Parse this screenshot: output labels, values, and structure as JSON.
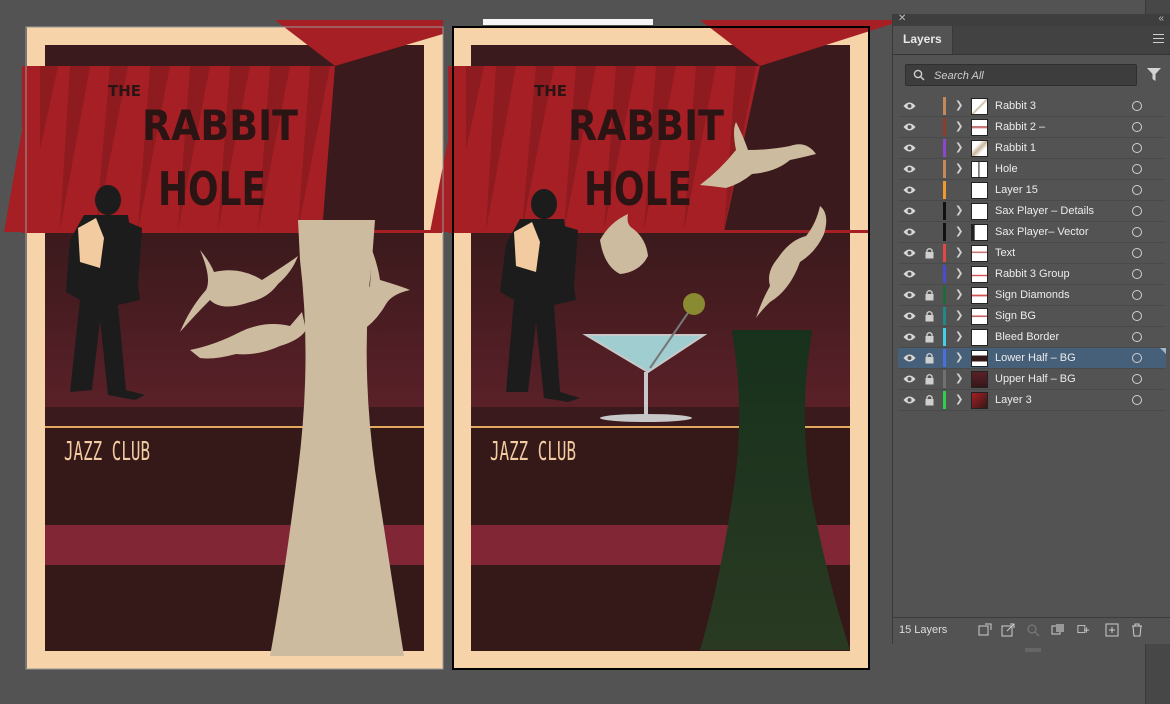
{
  "canvas": {
    "poster": {
      "sign_title_the": "THE",
      "sign_title_rabbit": "RABBIT",
      "sign_title_hole": "HOLE",
      "subtitle": "JAZZ CLUB"
    },
    "colors": {
      "cream_border": "#f6d3a8",
      "dark_maroon": "#351818",
      "upper_maroon": "#5a2028",
      "sign_red": "#a51f24",
      "stripe_red": "#802634",
      "rabbit_beige": "#cdbba0",
      "hole_green": "#1e3a22",
      "gold_line": "#e0a95e"
    }
  },
  "layers_panel": {
    "tab_label": "Layers",
    "search": {
      "placeholder": "Search All"
    },
    "layers": [
      {
        "name": "Rabbit 3",
        "color": "#c2895b",
        "locked": false,
        "expandable": true,
        "selected": false
      },
      {
        "name": "Rabbit 2 –",
        "color": "#8d3d2c",
        "locked": false,
        "expandable": true,
        "selected": false
      },
      {
        "name": "Rabbit 1",
        "color": "#8d46cc",
        "locked": false,
        "expandable": true,
        "selected": false
      },
      {
        "name": "Hole",
        "color": "#c2895b",
        "locked": false,
        "expandable": true,
        "selected": false
      },
      {
        "name": "Layer 15",
        "color": "#f29a2e",
        "locked": false,
        "expandable": false,
        "selected": false
      },
      {
        "name": "Sax Player – Details",
        "color": "#111111",
        "locked": false,
        "expandable": true,
        "selected": false
      },
      {
        "name": "Sax Player– Vector",
        "color": "#111111",
        "locked": false,
        "expandable": true,
        "selected": false
      },
      {
        "name": "Text",
        "color": "#e54646",
        "locked": true,
        "expandable": true,
        "selected": false
      },
      {
        "name": "Rabbit 3 Group",
        "color": "#4b4bd1",
        "locked": false,
        "expandable": true,
        "selected": false
      },
      {
        "name": "Sign Diamonds",
        "color": "#1f6b3a",
        "locked": true,
        "expandable": true,
        "selected": false
      },
      {
        "name": "Sign BG",
        "color": "#1f8a8a",
        "locked": true,
        "expandable": true,
        "selected": false
      },
      {
        "name": "Bleed Border",
        "color": "#3fd2e8",
        "locked": true,
        "expandable": true,
        "selected": false
      },
      {
        "name": "Lower Half – BG",
        "color": "#4b6fe0",
        "locked": true,
        "expandable": true,
        "selected": true
      },
      {
        "name": "Upper Half – BG",
        "color": "#707070",
        "locked": true,
        "expandable": true,
        "selected": false
      },
      {
        "name": "Layer 3",
        "color": "#2fd04a",
        "locked": true,
        "expandable": true,
        "selected": false
      }
    ],
    "footer": {
      "layer_count": "15 Layers"
    }
  }
}
